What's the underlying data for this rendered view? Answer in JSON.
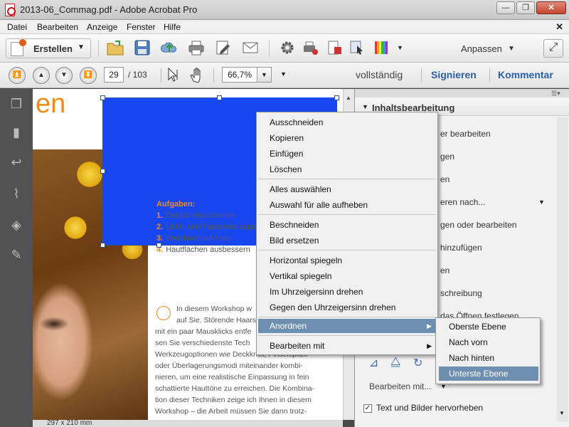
{
  "window": {
    "title": "2013-06_Commag.pdf - Adobe Acrobat Pro",
    "min": "—",
    "max": "❐",
    "close": "✕"
  },
  "menubar": {
    "items": [
      "Datei",
      "Bearbeiten",
      "Anzeige",
      "Fenster",
      "Hilfe"
    ],
    "close": "✕"
  },
  "toolbar1": {
    "create_label": "Erstellen",
    "customize_label": "Anpassen"
  },
  "toolbar2": {
    "page_current": "29",
    "page_total": "/ 103",
    "zoom": "66,7%",
    "mode_label": "vollständig",
    "sign_label": "Signieren",
    "comment_label": "Kommentar"
  },
  "document": {
    "heading_fragment": "en",
    "aufgaben_title": "Aufgaben:",
    "aufgaben_items": [
      {
        "num": "1.",
        "text": "Details retuschieren"
      },
      {
        "num": "2.",
        "text": "Licht- und Farbwerte anpassen"
      },
      {
        "num": "3.",
        "text": "Weichheit erhöhen"
      },
      {
        "num": "4.",
        "text": "Hautflächen ausbessern"
      }
    ],
    "body_lines": [
      "In diesem Workshop w",
      "auf Sie. Störende Haars",
      "mit ein paar Mausklicks entfe",
      "sen Sie verschiedenste Tech",
      "Werkzeugoptionen wie Deckkraft, Pinselspitze",
      "oder Überlagerungsmodi miteinander kombi-",
      "nieren, um eine realistische Einpassung in fein",
      "schattierte Hauttöne zu erreichen. Die Kombina-",
      "tion dieser Techniken zeige ich Ihnen in diesem",
      "Workshop – die Arbeit müssen Sie dann trotz-"
    ],
    "page_size": "297 x 210 mm"
  },
  "right_pane": {
    "header": "Inhaltsbearbeitung",
    "items": [
      "er bearbeiten",
      "gen",
      "en",
      "eren nach...",
      "gen oder bearbeiten",
      "hinzufügen",
      "en",
      "schreibung",
      "das Öffnen festlegen"
    ],
    "edit_with": "Bearbeiten mit...",
    "checkbox_label": "Text und Bilder hervorheben",
    "checkbox_mark": "✓"
  },
  "context_menu": {
    "items": [
      "Ausschneiden",
      "Kopieren",
      "Einfügen",
      "Löschen",
      "Alles auswählen",
      "Auswahl für alle aufheben",
      "Beschneiden",
      "Bild ersetzen",
      "Horizontal spiegeln",
      "Vertikal spiegeln",
      "Im Uhrzeigersinn drehen",
      "Gegen den Uhrzeigersinn drehen",
      "Anordnen",
      "Bearbeiten mit"
    ],
    "submenu": [
      "Oberste Ebene",
      "Nach vorn",
      "Nach hinten",
      "Unterste Ebene"
    ]
  },
  "colors": {
    "accent_orange": "#f08a1f",
    "image_blue": "#1846f1",
    "highlight": "#6f8fb0",
    "link_blue": "#2b5fa3"
  }
}
